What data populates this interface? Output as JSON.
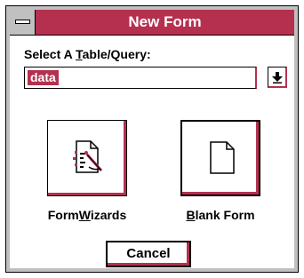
{
  "window": {
    "title": "New Form"
  },
  "table_query": {
    "label_prefix": "Select A ",
    "label_mnemonic": "T",
    "label_suffix": "able/Query:",
    "value": "data"
  },
  "buttons": {
    "form_wizards": {
      "label_prefix": "Form",
      "label_mnemonic": "W",
      "label_suffix": "izards"
    },
    "blank_form": {
      "label_mnemonic": "B",
      "label_suffix": "lank Form"
    },
    "cancel": "Cancel"
  },
  "icons": {
    "system_menu": "system-menu-icon",
    "dropdown": "dropdown-arrow-icon",
    "form_wizards": "magic-wand-document-icon",
    "blank_form": "blank-page-icon"
  },
  "colors": {
    "accent": "#b5304f",
    "face": "#c0c0c0"
  }
}
